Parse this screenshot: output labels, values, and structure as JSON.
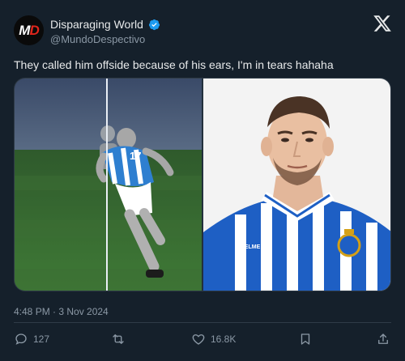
{
  "author": {
    "avatar_letters_main": "M",
    "avatar_letters_accent": "D",
    "display_name": "Disparaging World",
    "handle": "@MundoDespectivo",
    "verified_icon": "verified-badge-icon",
    "verified_color": "#1d9bf0"
  },
  "brand_icon": "x-logo-icon",
  "tweet": {
    "text": "They called him offside because of his ears, I'm in tears hahaha",
    "timestamp": "4:48 PM · 3 Nov 2024"
  },
  "media": {
    "left_image": "offside-var-render-image",
    "right_image": "player-portrait-image",
    "jersey_number": "17",
    "sponsor_text": "KELME"
  },
  "actions": {
    "replies": "127",
    "reposts": "",
    "likes": "16.8K"
  },
  "colors": {
    "background": "#15202b",
    "text": "#e7e9ea",
    "muted": "#8b98a5",
    "accent": "#1d9bf0"
  }
}
